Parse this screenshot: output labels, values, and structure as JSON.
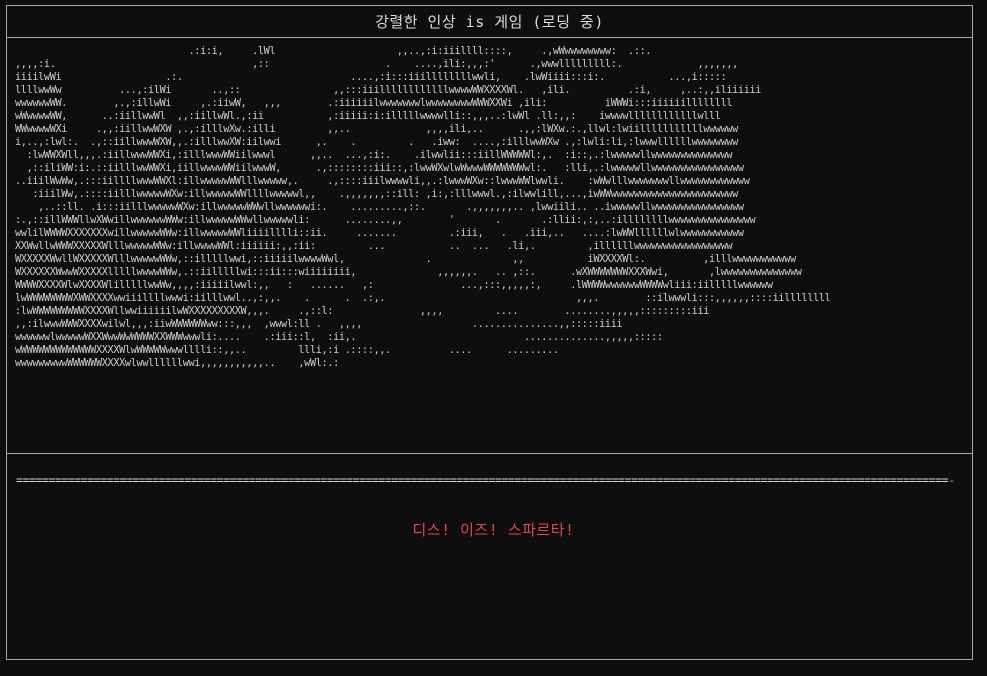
{
  "window": {
    "title": "강렬한 인상 is 게임 (로딩 중)"
  },
  "ascii_art": {
    "lines": [
      "                              .:i:i,     .lWl                     ,,..,:i:iiillll::::,     .,wWwwwwwwww:  .::.              ",
      ",,,,:i.                                  ,::                    .    ....,ili:,,,:'      .,wwwlllllllll:.             ,,,,,,,",
      "iiiilwWi                  .:.                             ....,:i:::iiillllllllwwli,    .lwWiiii:::i:.           ...,i:::::",
      "llllwwWw          ...,:ilWi       ..,::                ,,:::iiillllllllllllwwwwWWXXXXWl.   ,ili.          .:i,     ,..:,,iliiiiii",
      "wwwwwwWW.        ,.,:illwWi     ,.:iiwW,   ,,,        .:iiiiiilwwwwwwwlwwwwwwwwWWWXXWi ,ili:          iWWWi:::iiiiiillllllll",
      "wWwwwwWW,      ..:iillwwWl  ,,:iillwWl.,:ii           ,:iiiii:i:illlllwwwwlli::,,,..:lwWl .ll:,,:    iwwwwllllllllllllwlll",
      "WWwwwwWXi     .,,:iillwwWXW ,.,:illlwXw.:illi         ,,..             ,,,,ili,..      .,,:lWXw.:.,llwl:lwiilllllllllllwwwwww",
      "i,..,:lwl:.  .,::iillwwwWXW,,.:illlwwXW:iilwwi      ,.    .         .   .iww:  ....,:illlwwWXw .,:lwli:li,:lwwwllllllwwwwwwww",
      "  :lwWWXWll,,,.:iillwwwWWXi,:illlwwwWWiilwwwl      ,,..  ...,:i:.    .ilwwlii:::iillWWWWWl:,.  :i::,.:lwwwwwllwwwwwwwwwwwwww",
      "  ,::iliWW:i:.::iilllwwWWXi,iillwwwwWWiilwwwW,      .,::::::::iii::,:lwwWXwlwWwwwWWWWWWWwl:.   :lli,.:lwwwwwllwwwwwwwwwwwwwwww",
      "..iiilWwWw,.:::iillllwwwWWXl:illwwwwwWWlllwwwww,.     .,::::iiilwwwwli,,.:lwwwWXw::lwwwWWlwwli.    :wWwlllwwwwwwwllwwwwwwwwwwww",
      "   :iiilWw,.::::iilllwwwwwWXw:illwwwwwWWllllwwwwwl,,    .,,,,,,,::ill: ,i:,:lllwwwl.,:ilwwlill,...,iwWWwwwwwwwwwwwwwwwwwwwwww",
      "    ,..::ll. .i:::iilllwwwwwWXw:illwwwwwWWwllwwwwwwi:.    .........,::.       .,,,,,,,.. ,lwwiili.. ..iwwwwwllwwwwwwwwwwwwwwww",
      ":.,::illWWWllwXWwillwwwwwwWWw:illwwwwwWWwllwwwwwli:      ........,,        '       .       .:llii:,:,..:illllllllwwwwwwwwwwwwwww",
      "wwlilWWWWXXXXXXXwillwwwwwWWw:illwwwwwWWliiiilllli::ii.     .......         .:iii,   .   .iii,..   ....:lwWWllllllwlwwwwwwwwwww",
      "XXWwllwWWWXXXXXWlllwwwwwWWw:illwwwwWWl:iiiiii:,,:ii:         ...           ..  ...   .li,.         ,illllllwwwwwwwwwwwwwwwww",
      "WXXXXXWwllWXXXXXWlllwwwwwWWw,::illlllwwi,::iiiiilwwwwWwl,              .              ,,           iWXXXXWl:.          ,illlwwwwwwwwwww",
      "WXXXXXXWwwWXXXXXlllllwwwwWWw,.::iilllllwi:::ii:::wiiiiiiii,              ,,,,,,.   .. ,::.      .wXWWWWWWWXXXWwi,       ,lwwwwwwwwwwwwww",
      "WWWWXXXXWlwXXXXWlilllllwwWw,,,,:iiiiilwwl:,,   :   ......   ,:               ...,:::,,,,,:,     .lWWWWwwwwwwWWWWwliii:iilllllwwwwww",
      "lwWWWWWWWWXWWXXXXwwiiillllwwwi:iilllwwl..,:,,.    .      .  .:,.                                 ,,,.        ::ilwwwli:::,,,,,,::::iillllllll",
      ":lwWWWWWWWWWXXXXWllwwiiiiiilwWXXXXXXXXXW,,,.     .,::l:               ,,,,         ....        ........,,,,,:::::::::iii",
      ",,:ilwwwWWWXXXXwilwl,,,:iiwWWWWWWww:::,,,  ,wwwl:ll .   ,,,,                   ...............,,:::::iiii",
      "wwwwwwlwwwwwWXXWwwWwWWWWXXWWWwwwli:....    .:iii::l,  :ii,.                             ..............,,,,,:::::",
      "wWWWWWWWWWWWWWXXXXWlwWWWWWwwwlllli::,,..         llli,:i .::::,,.          ....      .........",
      "wwwwwwwwwWWWWWWXXXXwlwwllllllwwi,,,,,,,,,,,..    ,wWl:.:                                           "
    ]
  },
  "loading": {
    "bar_filled": "================================================================================================================================================",
    "bar_remaining": "--------------------",
    "progress_percent": 88
  },
  "message": {
    "text": "디스! 이즈! 스파르타!"
  },
  "colors": {
    "background": "#0e0e0e",
    "border": "#a8a8a8",
    "text": "#d6d6d6",
    "message": "#e0464d"
  }
}
